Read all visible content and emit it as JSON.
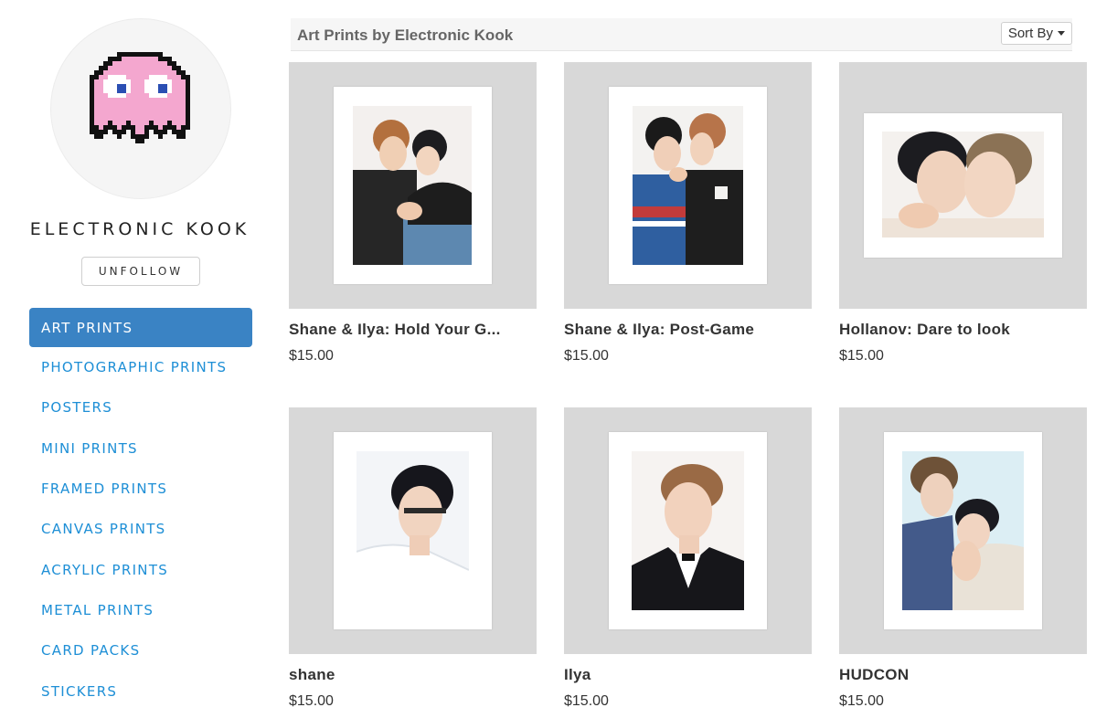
{
  "sidebar": {
    "artist_name": "ELECTRONIC KOOK",
    "follow_label": "UNFOLLOW",
    "avatar_icon": "pink-ghost-icon",
    "categories": [
      {
        "label": "ART PRINTS",
        "active": true
      },
      {
        "label": "PHOTOGRAPHIC PRINTS",
        "active": false
      },
      {
        "label": "POSTERS",
        "active": false
      },
      {
        "label": "MINI PRINTS",
        "active": false
      },
      {
        "label": "FRAMED PRINTS",
        "active": false
      },
      {
        "label": "CANVAS PRINTS",
        "active": false
      },
      {
        "label": "ACRYLIC PRINTS",
        "active": false
      },
      {
        "label": "METAL PRINTS",
        "active": false
      },
      {
        "label": "CARD PACKS",
        "active": false
      },
      {
        "label": "STICKERS",
        "active": false
      }
    ]
  },
  "main": {
    "header_title": "Art Prints by Electronic Kook",
    "sort_label": "Sort By",
    "products": [
      {
        "title": "Shane & Ilya: Hold Your G...",
        "price": "$15.00"
      },
      {
        "title": "Shane & Ilya: Post-Game",
        "price": "$15.00"
      },
      {
        "title": "Hollanov: Dare to look",
        "price": "$15.00"
      },
      {
        "title": "shane",
        "price": "$15.00"
      },
      {
        "title": "Ilya",
        "price": "$15.00"
      },
      {
        "title": "HUDCON",
        "price": "$15.00"
      }
    ]
  },
  "colors": {
    "accent": "#3a83c4",
    "link": "#1e8fd6",
    "ghost_pink": "#f4a7cf",
    "frame_gray": "#d8d8d8"
  }
}
